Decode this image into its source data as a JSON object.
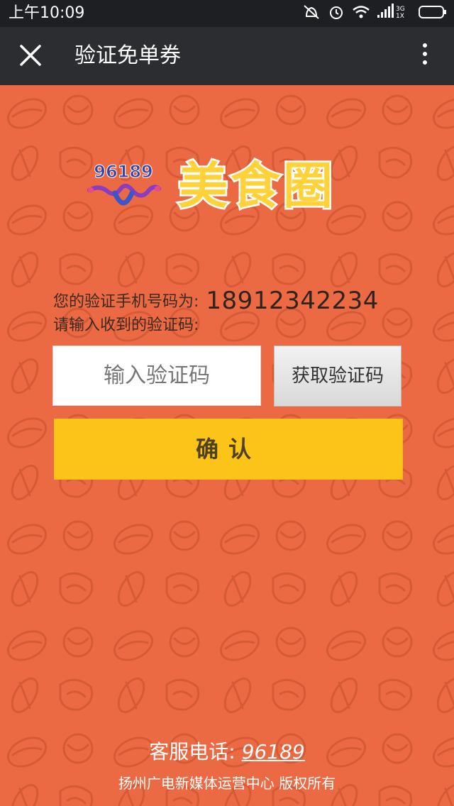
{
  "status_bar": {
    "time": "上午10:09",
    "network_label_top": "3G",
    "network_label_bottom": "1X"
  },
  "header": {
    "title": "验证免单券",
    "close_icon": "close-icon",
    "more_icon": "more-vertical-icon"
  },
  "logos": {
    "number_logo": "96189",
    "brand_logo": "美食圈"
  },
  "form": {
    "phone_label": "您的验证手机号码为:",
    "phone_number": "18912342234",
    "prompt_label": "请输入收到的验证码:",
    "code_placeholder": "输入验证码",
    "code_value": "",
    "get_code_label": "获取验证码",
    "confirm_label": "确认"
  },
  "footer": {
    "hotline_label": "客服电话:",
    "hotline_number": "96189",
    "copyright": "扬州广电新媒体运营中心 版权所有"
  },
  "colors": {
    "background": "#ec6a43",
    "status_bar": "#1d1f22",
    "title_bar": "#2b2d30",
    "confirm_button": "#fcc319",
    "brand_yellow": "#ffd23a"
  }
}
